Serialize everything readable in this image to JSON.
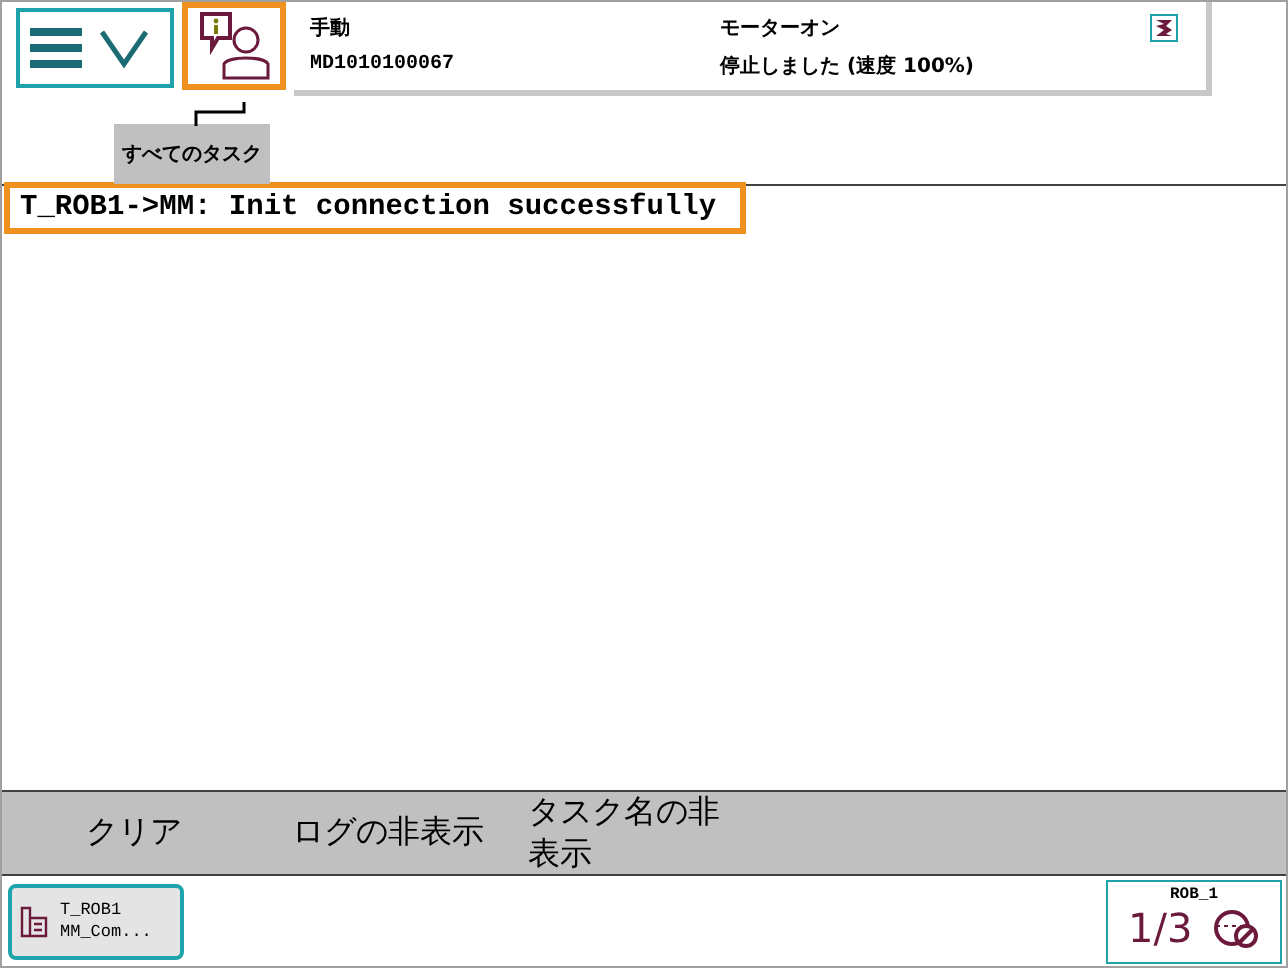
{
  "status": {
    "mode": "手動",
    "controller": "MD1010100067",
    "motor": "モーターオン",
    "state": "停止しました (速度 100%)"
  },
  "tabs": [
    {
      "label": "すべてのタスク",
      "selected": true
    }
  ],
  "log": [
    {
      "text": "T_ROB1->MM: Init connection successfully",
      "selected": true
    }
  ],
  "commands": [
    "クリア",
    "ログの非表示",
    "タスク名の非表示"
  ],
  "taskbar": [
    {
      "lines": [
        "T_ROB1",
        "MM_Com..."
      ],
      "selected": true
    }
  ],
  "quickset": {
    "unit": "ROB_1",
    "increment": "1/3"
  }
}
